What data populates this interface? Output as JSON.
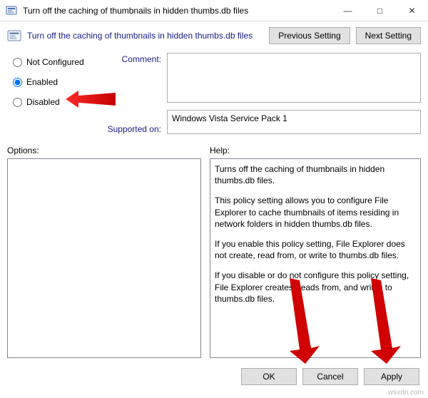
{
  "window": {
    "title": "Turn off the caching of thumbnails in hidden thumbs.db files"
  },
  "header": {
    "subtitle": "Turn off the caching of thumbnails in hidden thumbs.db files",
    "prev_btn": "Previous Setting",
    "next_btn": "Next Setting"
  },
  "radios": {
    "not_configured": "Not Configured",
    "enabled": "Enabled",
    "disabled": "Disabled"
  },
  "labels": {
    "comment": "Comment:",
    "supported": "Supported on:",
    "options": "Options:",
    "help": "Help:"
  },
  "fields": {
    "comment_value": "",
    "supported_value": "Windows Vista Service Pack 1"
  },
  "help": {
    "p1": "Turns off the caching of thumbnails in hidden thumbs.db files.",
    "p2": "This policy setting allows you to configure File Explorer to cache thumbnails of items residing in network folders in hidden thumbs.db files.",
    "p3": "If you enable this policy setting, File Explorer does not create, read from, or write to thumbs.db files.",
    "p4": "If you disable or do not configure this policy setting, File Explorer creates, reads from, and writes to thumbs.db files."
  },
  "footer": {
    "ok": "OK",
    "cancel": "Cancel",
    "apply": "Apply"
  },
  "watermark": "wsxdn.com"
}
